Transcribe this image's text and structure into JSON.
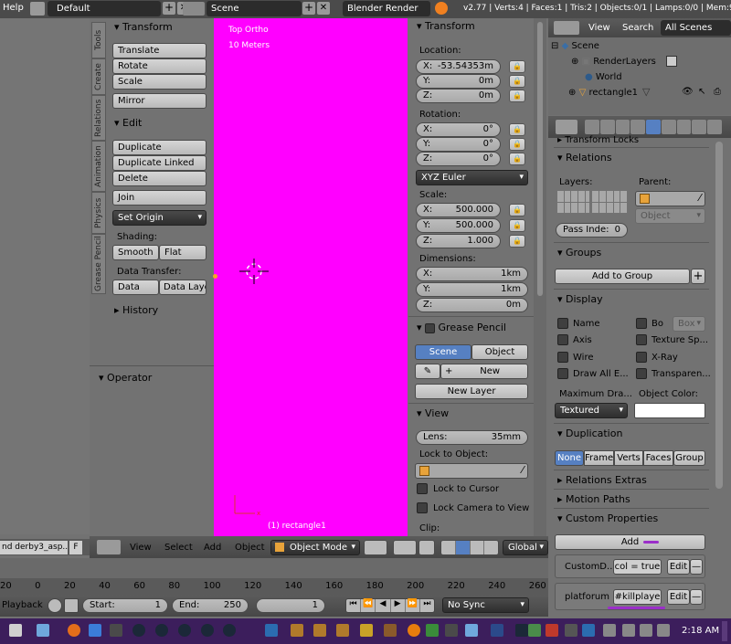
{
  "topbar": {
    "help": "Help",
    "layout": "Default",
    "scene": "Scene",
    "engine": "Blender Render",
    "stats": "v2.77 | Verts:4 | Faces:1 | Tris:2 | Objects:0/1 | Lamps:0/0 | Mem:9."
  },
  "vtabs": [
    "Tools",
    "Create",
    "Relations",
    "Animation",
    "Physics",
    "Grease Pencil"
  ],
  "tools": {
    "transform_title": "Transform",
    "translate": "Translate",
    "rotate": "Rotate",
    "scale": "Scale",
    "mirror": "Mirror",
    "edit_title": "Edit",
    "duplicate": "Duplicate",
    "duplicate_linked": "Duplicate Linked",
    "delete": "Delete",
    "join": "Join",
    "set_origin": "Set Origin",
    "shading": "Shading:",
    "smooth": "Smooth",
    "flat": "Flat",
    "data_transfer": "Data Transfer:",
    "data": "Data",
    "data_layo": "Data Layo",
    "history": "History",
    "operator": "Operator"
  },
  "viewport": {
    "view_name": "Top Ortho",
    "scale_text": "10 Meters",
    "object_label": "(1) rectangle1",
    "bg_color": "#ff00ff"
  },
  "npanel": {
    "transform_title": "Transform",
    "location": "Location:",
    "loc": [
      {
        "a": "X:",
        "v": "-53.54353m"
      },
      {
        "a": "Y:",
        "v": "0m"
      },
      {
        "a": "Z:",
        "v": "0m"
      }
    ],
    "rotation": "Rotation:",
    "rot": [
      {
        "a": "X:",
        "v": "0°"
      },
      {
        "a": "Y:",
        "v": "0°"
      },
      {
        "a": "Z:",
        "v": "0°"
      }
    ],
    "rot_mode": "XYZ Euler",
    "scale": "Scale:",
    "scl": [
      {
        "a": "X:",
        "v": "500.000"
      },
      {
        "a": "Y:",
        "v": "500.000"
      },
      {
        "a": "Z:",
        "v": "1.000"
      }
    ],
    "dimensions": "Dimensions:",
    "dim": [
      {
        "a": "X:",
        "v": "1km"
      },
      {
        "a": "Y:",
        "v": "1km"
      },
      {
        "a": "Z:",
        "v": "0m"
      }
    ],
    "grease_title": "Grease Pencil",
    "gp_scene": "Scene",
    "gp_object": "Object",
    "gp_new": "New",
    "gp_new_layer": "New Layer",
    "view_title": "View",
    "lens_label": "Lens:",
    "lens_value": "35mm",
    "lock_to_object": "Lock to Object:",
    "lock_to_cursor": "Lock to Cursor",
    "lock_camera": "Lock Camera to View",
    "clip": "Clip:"
  },
  "outliner": {
    "view": "View",
    "search": "Search",
    "all_scenes": "All Scenes",
    "items": [
      "Scene",
      "RenderLayers",
      "World",
      "rectangle1"
    ]
  },
  "props": {
    "transform_locks": "Transform Locks",
    "relations": "Relations",
    "layers": "Layers:",
    "parent": "Parent:",
    "parent_type": "Object",
    "pass_index_label": "Pass Inde:",
    "pass_index_value": "0",
    "groups": "Groups",
    "add_to_group": "Add to Group",
    "display": "Display",
    "disp_left": [
      "Name",
      "Axis",
      "Wire",
      "Draw All E..."
    ],
    "disp_right": [
      "Bo",
      "Texture Sp...",
      "X-Ray",
      "Transparen..."
    ],
    "box_option": "Box",
    "max_draw": "Maximum Dra...",
    "object_color": "Object Color:",
    "draw_type": "Textured",
    "object_color_value": "#ffffff",
    "duplication": "Duplication",
    "dup_options": [
      "None",
      "Frames",
      "Verts",
      "Faces",
      "Group"
    ],
    "relations_extras": "Relations Extras",
    "motion_paths": "Motion Paths",
    "custom_props": "Custom Properties",
    "add": "Add",
    "prop1_name": "CustomD...",
    "prop1_value": "col = true",
    "prop2_name": "platforum",
    "prop2_value": "#killplaye",
    "edit": "Edit",
    "minus": "—"
  },
  "view3d_header": {
    "view": "View",
    "select": "Select",
    "add": "Add",
    "object": "Object",
    "mode": "Object Mode",
    "global": "Global"
  },
  "file_tab": "nd derby3_asp...",
  "file_tab_f": "F",
  "timeline": {
    "ticks": [
      "20",
      "0",
      "20",
      "40",
      "60",
      "80",
      "100",
      "120",
      "140",
      "160",
      "180",
      "200",
      "220",
      "240",
      "260"
    ],
    "playback": "Playback",
    "start_label": "Start:",
    "start_value": "1",
    "end_label": "End:",
    "end_value": "250",
    "current": "1",
    "sync": "No Sync"
  },
  "taskbar": {
    "time": "2:18 AM"
  },
  "accent_blue": "#5680c2",
  "annotation_color": "#9b2fc9"
}
